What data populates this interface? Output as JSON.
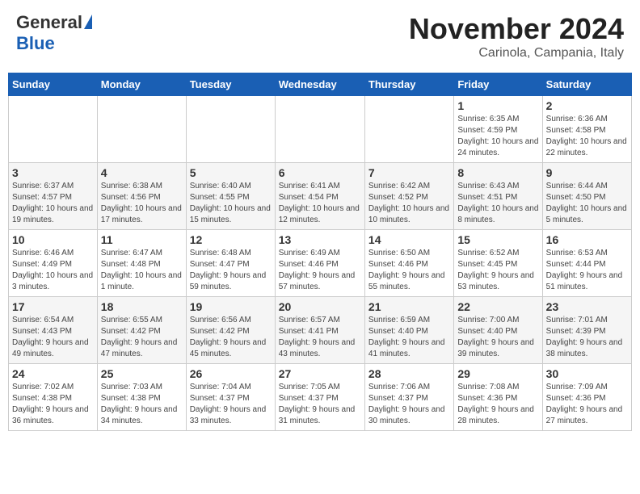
{
  "header": {
    "logo_general": "General",
    "logo_blue": "Blue",
    "month": "November 2024",
    "location": "Carinola, Campania, Italy"
  },
  "days_of_week": [
    "Sunday",
    "Monday",
    "Tuesday",
    "Wednesday",
    "Thursday",
    "Friday",
    "Saturday"
  ],
  "weeks": [
    [
      {
        "day": "",
        "info": ""
      },
      {
        "day": "",
        "info": ""
      },
      {
        "day": "",
        "info": ""
      },
      {
        "day": "",
        "info": ""
      },
      {
        "day": "",
        "info": ""
      },
      {
        "day": "1",
        "info": "Sunrise: 6:35 AM\nSunset: 4:59 PM\nDaylight: 10 hours and 24 minutes."
      },
      {
        "day": "2",
        "info": "Sunrise: 6:36 AM\nSunset: 4:58 PM\nDaylight: 10 hours and 22 minutes."
      }
    ],
    [
      {
        "day": "3",
        "info": "Sunrise: 6:37 AM\nSunset: 4:57 PM\nDaylight: 10 hours and 19 minutes."
      },
      {
        "day": "4",
        "info": "Sunrise: 6:38 AM\nSunset: 4:56 PM\nDaylight: 10 hours and 17 minutes."
      },
      {
        "day": "5",
        "info": "Sunrise: 6:40 AM\nSunset: 4:55 PM\nDaylight: 10 hours and 15 minutes."
      },
      {
        "day": "6",
        "info": "Sunrise: 6:41 AM\nSunset: 4:54 PM\nDaylight: 10 hours and 12 minutes."
      },
      {
        "day": "7",
        "info": "Sunrise: 6:42 AM\nSunset: 4:52 PM\nDaylight: 10 hours and 10 minutes."
      },
      {
        "day": "8",
        "info": "Sunrise: 6:43 AM\nSunset: 4:51 PM\nDaylight: 10 hours and 8 minutes."
      },
      {
        "day": "9",
        "info": "Sunrise: 6:44 AM\nSunset: 4:50 PM\nDaylight: 10 hours and 5 minutes."
      }
    ],
    [
      {
        "day": "10",
        "info": "Sunrise: 6:46 AM\nSunset: 4:49 PM\nDaylight: 10 hours and 3 minutes."
      },
      {
        "day": "11",
        "info": "Sunrise: 6:47 AM\nSunset: 4:48 PM\nDaylight: 10 hours and 1 minute."
      },
      {
        "day": "12",
        "info": "Sunrise: 6:48 AM\nSunset: 4:47 PM\nDaylight: 9 hours and 59 minutes."
      },
      {
        "day": "13",
        "info": "Sunrise: 6:49 AM\nSunset: 4:46 PM\nDaylight: 9 hours and 57 minutes."
      },
      {
        "day": "14",
        "info": "Sunrise: 6:50 AM\nSunset: 4:46 PM\nDaylight: 9 hours and 55 minutes."
      },
      {
        "day": "15",
        "info": "Sunrise: 6:52 AM\nSunset: 4:45 PM\nDaylight: 9 hours and 53 minutes."
      },
      {
        "day": "16",
        "info": "Sunrise: 6:53 AM\nSunset: 4:44 PM\nDaylight: 9 hours and 51 minutes."
      }
    ],
    [
      {
        "day": "17",
        "info": "Sunrise: 6:54 AM\nSunset: 4:43 PM\nDaylight: 9 hours and 49 minutes."
      },
      {
        "day": "18",
        "info": "Sunrise: 6:55 AM\nSunset: 4:42 PM\nDaylight: 9 hours and 47 minutes."
      },
      {
        "day": "19",
        "info": "Sunrise: 6:56 AM\nSunset: 4:42 PM\nDaylight: 9 hours and 45 minutes."
      },
      {
        "day": "20",
        "info": "Sunrise: 6:57 AM\nSunset: 4:41 PM\nDaylight: 9 hours and 43 minutes."
      },
      {
        "day": "21",
        "info": "Sunrise: 6:59 AM\nSunset: 4:40 PM\nDaylight: 9 hours and 41 minutes."
      },
      {
        "day": "22",
        "info": "Sunrise: 7:00 AM\nSunset: 4:40 PM\nDaylight: 9 hours and 39 minutes."
      },
      {
        "day": "23",
        "info": "Sunrise: 7:01 AM\nSunset: 4:39 PM\nDaylight: 9 hours and 38 minutes."
      }
    ],
    [
      {
        "day": "24",
        "info": "Sunrise: 7:02 AM\nSunset: 4:38 PM\nDaylight: 9 hours and 36 minutes."
      },
      {
        "day": "25",
        "info": "Sunrise: 7:03 AM\nSunset: 4:38 PM\nDaylight: 9 hours and 34 minutes."
      },
      {
        "day": "26",
        "info": "Sunrise: 7:04 AM\nSunset: 4:37 PM\nDaylight: 9 hours and 33 minutes."
      },
      {
        "day": "27",
        "info": "Sunrise: 7:05 AM\nSunset: 4:37 PM\nDaylight: 9 hours and 31 minutes."
      },
      {
        "day": "28",
        "info": "Sunrise: 7:06 AM\nSunset: 4:37 PM\nDaylight: 9 hours and 30 minutes."
      },
      {
        "day": "29",
        "info": "Sunrise: 7:08 AM\nSunset: 4:36 PM\nDaylight: 9 hours and 28 minutes."
      },
      {
        "day": "30",
        "info": "Sunrise: 7:09 AM\nSunset: 4:36 PM\nDaylight: 9 hours and 27 minutes."
      }
    ]
  ]
}
